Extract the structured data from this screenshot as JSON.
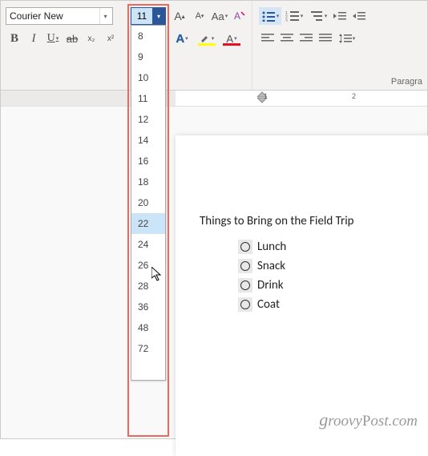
{
  "font": {
    "name": "Courier New",
    "size": "11",
    "sizes": [
      "8",
      "9",
      "10",
      "11",
      "12",
      "14",
      "16",
      "18",
      "20",
      "22",
      "24",
      "26",
      "28",
      "36",
      "48",
      "72"
    ],
    "hover_size": "22"
  },
  "toolbar": {
    "bold": "B",
    "italic": "I",
    "underline": "U",
    "strike": "ab",
    "grow": "A",
    "shrink": "A",
    "case": "Aa",
    "clear": "A",
    "effects": "A",
    "highlight": "ab",
    "fontcolor": "A",
    "sub": "x",
    "sup": "²"
  },
  "paragraph": {
    "label": "Paragra"
  },
  "colors": {
    "highlight": "#ffff00",
    "fontcolor": "#e81123",
    "effects": "#2b579a"
  },
  "ruler": {
    "marks": [
      {
        "pos": 328,
        "label": "1"
      },
      {
        "pos": 438,
        "label": "2"
      }
    ]
  },
  "document": {
    "title": "Things to Bring on the Field Trip",
    "items": [
      "Lunch",
      "Snack",
      "Drink",
      "Coat"
    ]
  },
  "watermark": "groovyPost.com"
}
